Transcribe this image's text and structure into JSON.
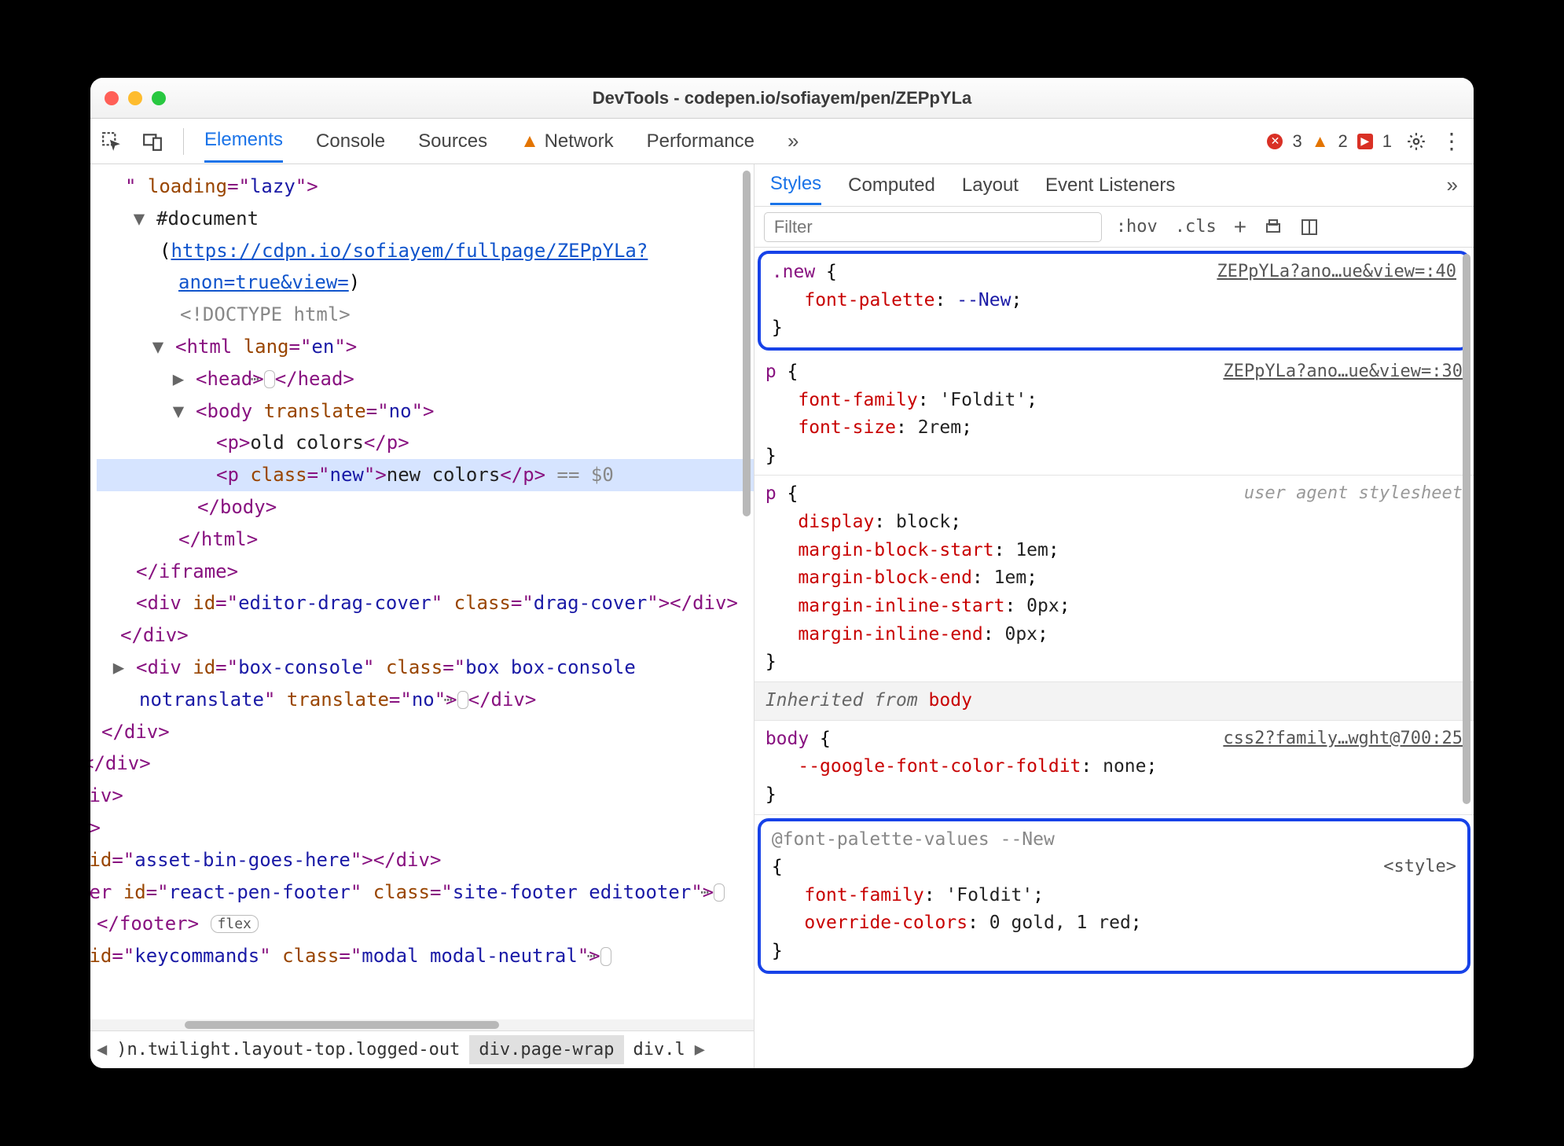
{
  "title": "DevTools - codepen.io/sofiayem/pen/ZEPpYLa",
  "tabs": {
    "elements": "Elements",
    "console": "Console",
    "sources": "Sources",
    "network": "Network",
    "performance": "Performance"
  },
  "status": {
    "errors": "3",
    "warnings": "2",
    "breakpoints": "1"
  },
  "dom": {
    "loading": "lazy",
    "iframe_url": "https://cdpn.io/sofiayem/fullpage/ZEPpYLa?anon=true&view=",
    "doctype": "<!DOCTYPE html>",
    "html_lang": "en",
    "body_translate": "no",
    "p1_text": "old colors",
    "p2_class": "new",
    "p2_text": "new colors",
    "dollar": "== $0",
    "drag_cover_id": "editor-drag-cover",
    "drag_cover_class": "drag-cover",
    "box_console_id": "box-console",
    "box_console_class": "box box-console notranslate",
    "box_console_translate": "no",
    "asset_bin_id": "asset-bin-goes-here",
    "footer_id": "react-pen-footer",
    "footer_class": "site-footer editooter",
    "flex_badge": "flex",
    "keycommands_id": "keycommands",
    "keycommands_class": "modal modal-neutral"
  },
  "breadcrumbs": {
    "c1": ")n.twilight.layout-top.logged-out",
    "c2": "div.page-wrap",
    "c3": "div.l"
  },
  "side_tabs": {
    "styles": "Styles",
    "computed": "Computed",
    "layout": "Layout",
    "listeners": "Event Listeners"
  },
  "filter_placeholder": "Filter",
  "toggles": {
    "hov": ":hov",
    "cls": ".cls"
  },
  "rules": {
    "r1": {
      "src": "ZEPpYLa?ano…ue&view=:40",
      "sel": ".new",
      "prop": "font-palette",
      "val": "--New"
    },
    "r2": {
      "src": "ZEPpYLa?ano…ue&view=:30",
      "sel": "p",
      "p1": "font-family",
      "v1": "'Foldit'",
      "p2": "font-size",
      "v2": "2rem"
    },
    "r3": {
      "src": "user agent stylesheet",
      "sel": "p",
      "p1": "display",
      "v1": "block",
      "p2": "margin-block-start",
      "v2": "1em",
      "p3": "margin-block-end",
      "v3": "1em",
      "p4": "margin-inline-start",
      "v4": "0px",
      "p5": "margin-inline-end",
      "v5": "0px"
    },
    "inh_label": "Inherited from ",
    "inh_from": "body",
    "r4": {
      "src": "css2?family…wght@700:25",
      "sel": "body",
      "p1": "--google-font-color-foldit",
      "v1": "none"
    },
    "r5": {
      "src": "<style>",
      "atrule": "@font-palette-values --New",
      "p1": "font-family",
      "v1": "'Foldit'",
      "p2": "override-colors",
      "v2": "0 gold, 1 red"
    }
  }
}
